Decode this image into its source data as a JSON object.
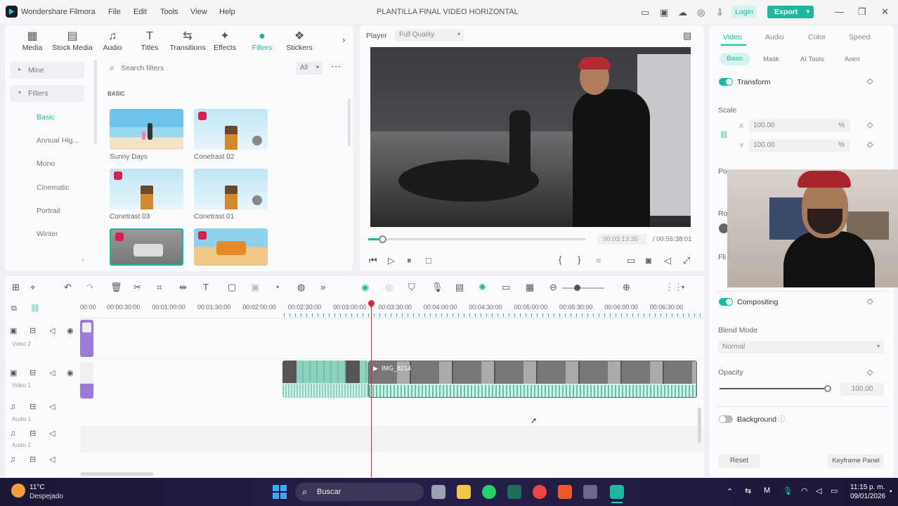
{
  "app": {
    "name": "Wondershare Filmora",
    "project_title": "PLANTILLA FINAL VIDEO HORIZONTAL",
    "login_label": "Login",
    "export_label": "Export"
  },
  "menu": [
    "File",
    "Edit",
    "Tools",
    "View",
    "Help"
  ],
  "toolbar": {
    "items": [
      {
        "label": "Media",
        "icon": "media-icon"
      },
      {
        "label": "Stock Media",
        "icon": "stock-media-icon"
      },
      {
        "label": "Audio",
        "icon": "music-note-icon"
      },
      {
        "label": "Titles",
        "icon": "text-icon"
      },
      {
        "label": "Transitions",
        "icon": "transitions-icon"
      },
      {
        "label": "Effects",
        "icon": "effects-icon"
      },
      {
        "label": "Filters",
        "icon": "filters-icon"
      },
      {
        "label": "Stickers",
        "icon": "stickers-icon"
      }
    ]
  },
  "sidebar": {
    "mine": "Mine",
    "filters": "Filters",
    "items": [
      "Basic",
      "Annual Hig...",
      "Mono",
      "Cinematic",
      "Portrait",
      "Winter"
    ]
  },
  "search": {
    "placeholder": "Search filters",
    "filter_value": "All"
  },
  "library": {
    "section": "BASIC",
    "items": [
      "Sunny Days",
      "Conetrast 02",
      "Conetrast 03",
      "Conetrast 01"
    ]
  },
  "player": {
    "label": "Player",
    "quality": "Full Quality",
    "current_time": "00:03:13:35",
    "total_time": "/ 00:55:38:01"
  },
  "timeline": {
    "ruler": [
      "00:00",
      "00:00:30:00",
      "00:01:00:00",
      "00:01:30:00",
      "00:02:00:00",
      "00:02:30:00",
      "00:03:00:00",
      "00:03:30:00",
      "00:04:00:00",
      "00:04:30:00",
      "00:05:00:00",
      "00:05:30:00",
      "00:06:00:00",
      "00:06:30:00"
    ],
    "tracks": [
      "Video 2",
      "Video 1",
      "Audio 1",
      "Audio 2"
    ],
    "clip_label": "IMG_8214"
  },
  "properties": {
    "tabs": [
      "Video",
      "Audio",
      "Color",
      "Speed"
    ],
    "subtabs": [
      "Basic",
      "Mask",
      "AI Tools",
      "Anim"
    ],
    "transform": "Transform",
    "scale": "Scale",
    "x_value": "100.00",
    "y_value": "100.00",
    "x_label": "X",
    "y_label": "Y",
    "percent": "%",
    "position_partial": "Po",
    "rotate_partial": "Ro",
    "flip_partial": "Fli",
    "compositing": "Compositing",
    "blend_mode_label": "Blend Mode",
    "blend_mode_value": "Normal",
    "opacity_label": "Opacity",
    "opacity_value": "100.00",
    "background": "Background",
    "reset": "Reset",
    "keyframe_panel": "Keyframe Panel"
  },
  "taskbar": {
    "temp": "11°C",
    "weather": "Despejado",
    "search": "Buscar",
    "time": "11:15 p. m.",
    "date": "09/01/2026"
  },
  "colors": {
    "accent": "#19b8a0",
    "export": "#1fb89e",
    "playhead": "#e0263a",
    "taskbar": "#1e1a40"
  }
}
